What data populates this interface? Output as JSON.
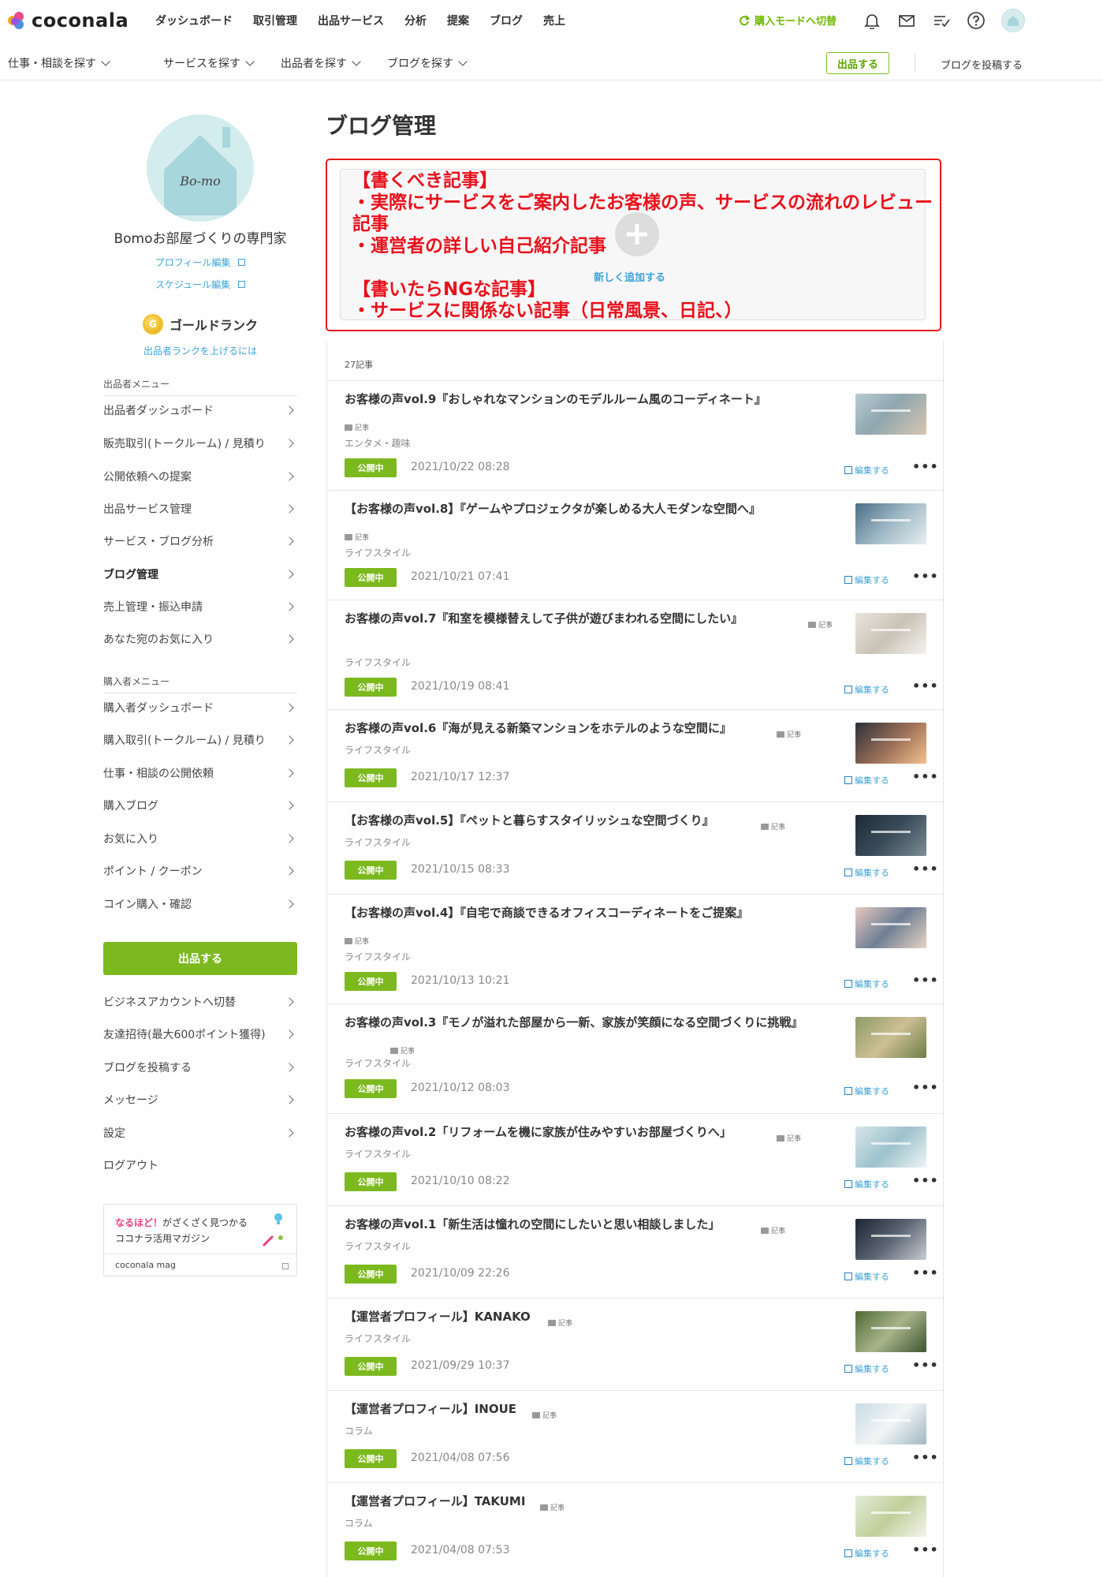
{
  "header": {
    "logo_text": "coconala",
    "nav": [
      "ダッシュボード",
      "取引管理",
      "出品サービス",
      "分析",
      "提案",
      "ブログ",
      "売上"
    ],
    "switch_mode": "購入モードへ切替",
    "icons": [
      "bell-icon",
      "mail-icon",
      "checklist-icon",
      "help-icon"
    ]
  },
  "subnav": {
    "items": [
      "仕事・相談を探す",
      "サービスを探す",
      "出品者を探す",
      "ブログを探す"
    ],
    "publish_button": "出品する",
    "post_blog": "ブログを投稿する"
  },
  "profile": {
    "avatar_text": "Bo-mo",
    "name": "Bomoお部屋づくりの専門家",
    "edit_profile": "プロフィール編集",
    "edit_schedule": "スケジュール編集",
    "rank_badge": "G",
    "rank": "ゴールドランク",
    "rank_link": "出品者ランクを上げるには"
  },
  "seller_menu": {
    "heading": "出品者メニュー",
    "items": [
      "出品者ダッシュボード",
      "販売取引(トークルーム) / 見積り",
      "公開依頼への提案",
      "出品サービス管理",
      "サービス・ブログ分析",
      "ブログ管理",
      "売上管理・振込申請",
      "あなた宛のお気に入り"
    ]
  },
  "buyer_menu": {
    "heading": "購入者メニュー",
    "items": [
      "購入者ダッシュボード",
      "購入取引(トークルーム) / 見積り",
      "仕事・相談の公開依頼",
      "購入ブログ",
      "お気に入り",
      "ポイント / クーポン",
      "コイン購入・確認"
    ]
  },
  "sidebar_publish": "出品する",
  "other_menu": {
    "items": [
      "ビジネスアカウントへ切替",
      "友達招待(最大600ポイント獲得)",
      "ブログを投稿する",
      "メッセージ",
      "設定"
    ],
    "logout": "ログアウト"
  },
  "magazine": {
    "highlight": "なるほど！",
    "line1_rest": "がざくざく見つかる",
    "line2": "ココナラ活用マガジン",
    "footer": "coconala mag"
  },
  "main": {
    "title": "ブログ管理",
    "add_new": "新しく追加する",
    "annotation": "【書くべき記事】\n・実際にサービスをご案内したお客様の声、サービスの流れのレビュー\n記事\n・運営者の詳しい自己紹介記事\n\n【書いたらNGな記事】\n・サービスに関係ない記事（日常風景、日記、）",
    "count": "27記事",
    "kiji_label": "記事",
    "status_label": "公開中",
    "edit_label": "編集する",
    "more_label": "•••",
    "posts": [
      {
        "title": "お客様の声vol.9『おしゃれなマンションのモデルルーム風のコーディネート』",
        "category": "エンタメ・趣味",
        "date": "2021/10/22 08:28"
      },
      {
        "title": "【お客様の声vol.8】『ゲームやプロジェクタが楽しめる大人モダンな空間へ』",
        "category": "ライフスタイル",
        "date": "2021/10/21 07:41"
      },
      {
        "title": "お客様の声vol.7『和室を模様替えして子供が遊びまわれる空間にしたい』",
        "category": "ライフスタイル",
        "date": "2021/10/19 08:41"
      },
      {
        "title": "お客様の声vol.6『海が見える新築マンションをホテルのような空間に』",
        "category": "ライフスタイル",
        "date": "2021/10/17 12:37"
      },
      {
        "title": "【お客様の声vol.5】『ペットと暮らすスタイリッシュな空間づくり』",
        "category": "ライフスタイル",
        "date": "2021/10/15 08:33"
      },
      {
        "title": "【お客様の声vol.4】『自宅で商談できるオフィスコーディネートをご提案』",
        "category": "ライフスタイル",
        "date": "2021/10/13 10:21"
      },
      {
        "title": "お客様の声vol.3『モノが溢れた部屋から一新、家族が笑顔になる空間づくりに挑戦』",
        "category": "ライフスタイル",
        "date": "2021/10/12 08:03"
      },
      {
        "title": "お客様の声vol.2「リフォームを機に家族が住みやすいお部屋づくりへ」",
        "category": "ライフスタイル",
        "date": "2021/10/10 08:22"
      },
      {
        "title": "お客様の声vol.1「新生活は憧れの空間にしたいと思い相談しました」",
        "category": "ライフスタイル",
        "date": "2021/10/09 22:26"
      },
      {
        "title": "【運営者プロフィール】KANAKO",
        "category": "ライフスタイル",
        "date": "2021/09/29 10:37"
      },
      {
        "title": "【運営者プロフィール】INOUE",
        "category": "コラム",
        "date": "2021/04/08 07:56"
      },
      {
        "title": "【運営者プロフィール】TAKUMI",
        "category": "コラム",
        "date": "2021/04/08 07:53"
      }
    ]
  },
  "colors": {
    "accent_green": "#7cb91f",
    "link_blue": "#3ba3d9",
    "annotation_red": "#e8101b"
  }
}
